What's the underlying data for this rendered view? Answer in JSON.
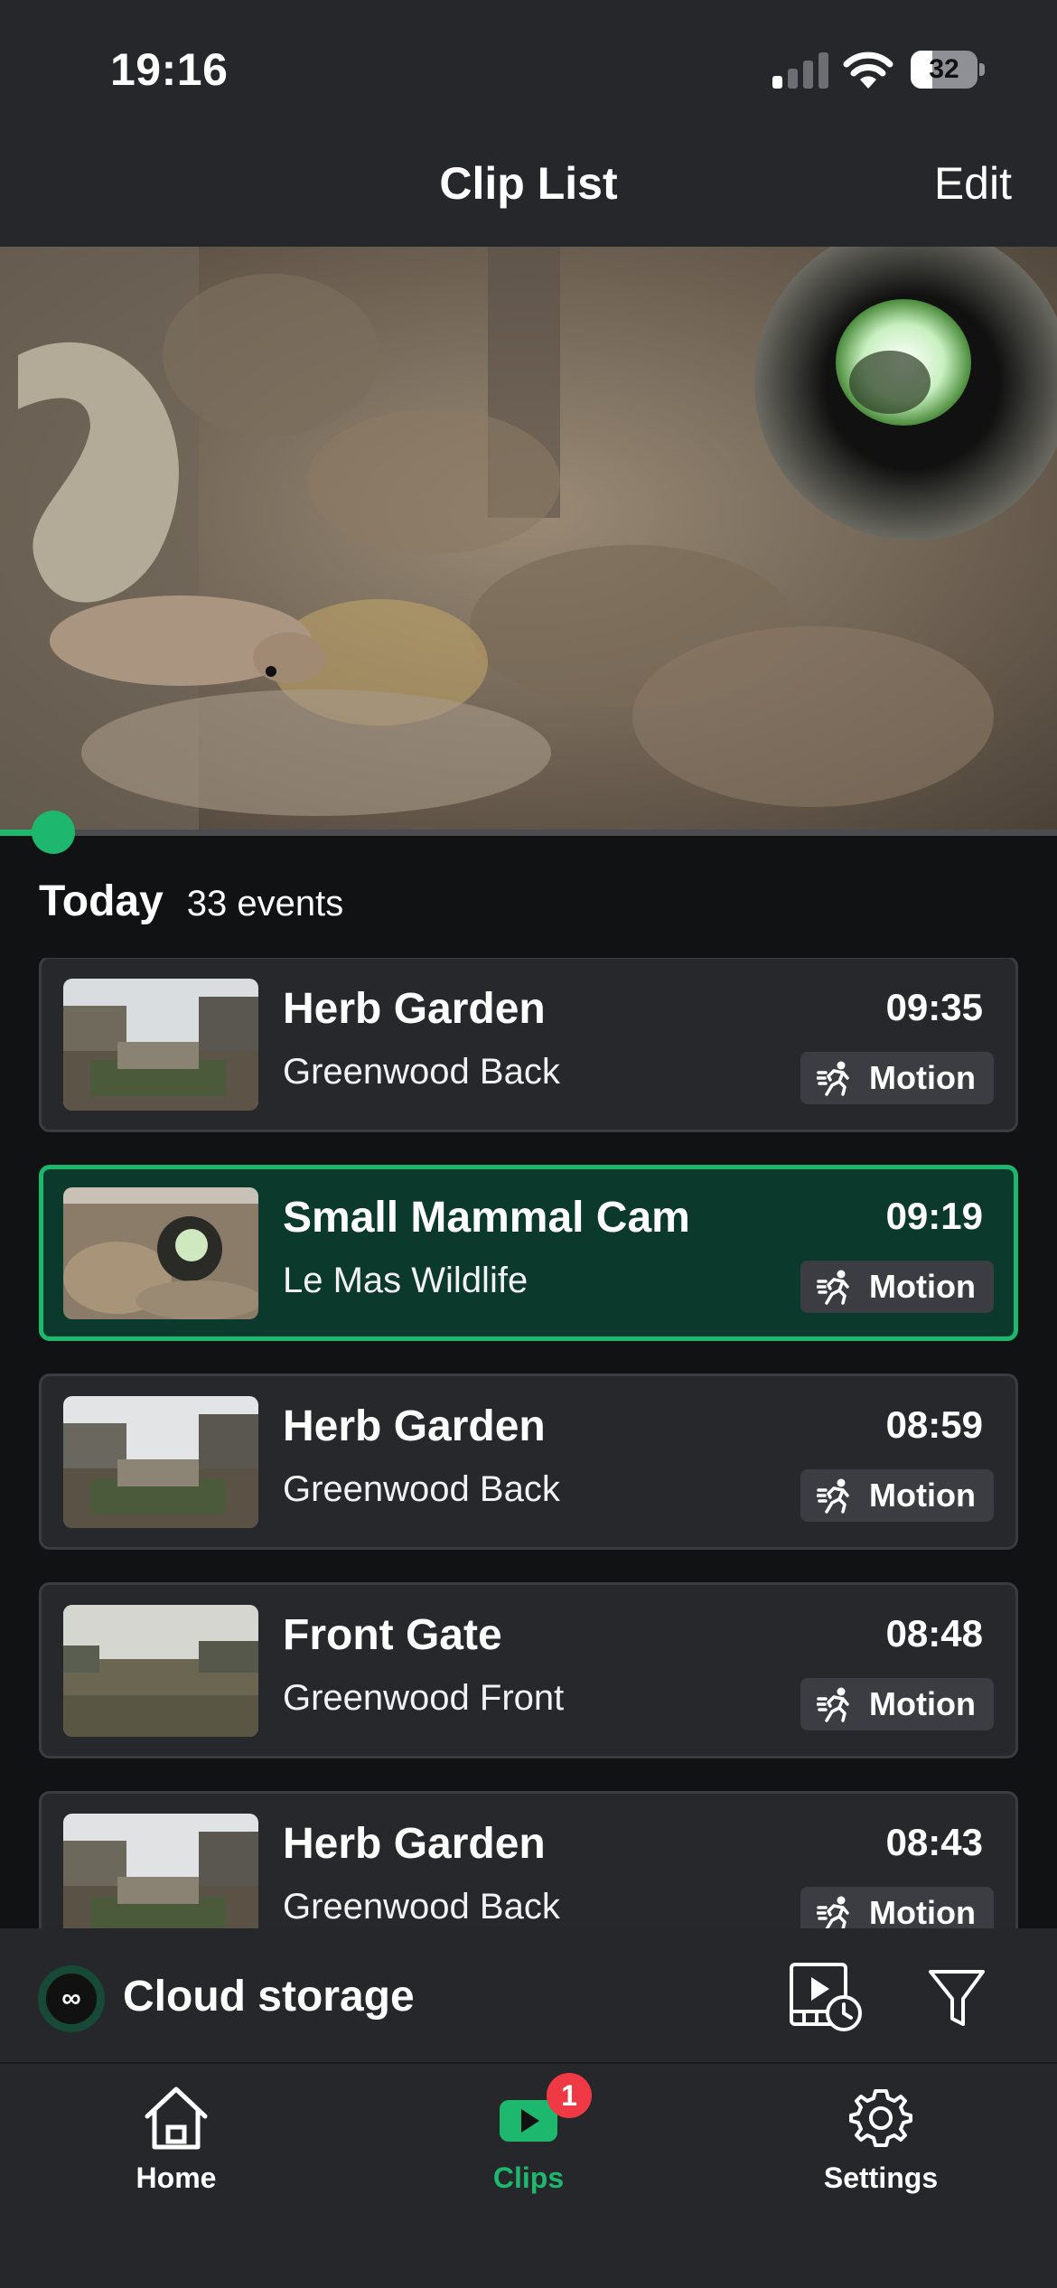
{
  "status_bar": {
    "time": "19:16",
    "battery_level": "32",
    "signal_bars_active": 1,
    "signal_bars_total": 4
  },
  "header": {
    "title": "Clip List",
    "edit_label": "Edit"
  },
  "player": {
    "progress_fraction": 0.05
  },
  "list": {
    "day_label": "Today",
    "event_count": "33 events",
    "clips": [
      {
        "name": "Herb Garden",
        "location": "Greenwood Back",
        "time": "09:35",
        "badge": "Motion",
        "badge_icon": "running-person-icon",
        "thumb": "garden",
        "selected": false
      },
      {
        "name": "Small Mammal Cam",
        "location": "Le Mas Wildlife",
        "time": "09:19",
        "badge": "Motion",
        "badge_icon": "running-person-icon",
        "thumb": "mammal",
        "selected": true
      },
      {
        "name": "Herb Garden",
        "location": "Greenwood Back",
        "time": "08:59",
        "badge": "Motion",
        "badge_icon": "running-person-icon",
        "thumb": "garden",
        "selected": false
      },
      {
        "name": "Front Gate",
        "location": "Greenwood Front",
        "time": "08:48",
        "badge": "Motion",
        "badge_icon": "running-person-icon",
        "thumb": "field",
        "selected": false
      },
      {
        "name": "Herb Garden",
        "location": "Greenwood Back",
        "time": "08:43",
        "badge": "Motion",
        "badge_icon": "running-person-icon",
        "thumb": "garden",
        "selected": false
      }
    ]
  },
  "cloud": {
    "icon_text": "∞",
    "label": "Cloud storage"
  },
  "tabs": [
    {
      "label": "Home",
      "icon": "home-icon",
      "active": false
    },
    {
      "label": "Clips",
      "icon": "play-icon",
      "active": true,
      "badge": "1"
    },
    {
      "label": "Settings",
      "icon": "gear-icon",
      "active": false
    }
  ],
  "colors": {
    "accent": "#1db86e",
    "badge_red": "#ef3a45",
    "selected_bg": "#0b3a2c"
  }
}
